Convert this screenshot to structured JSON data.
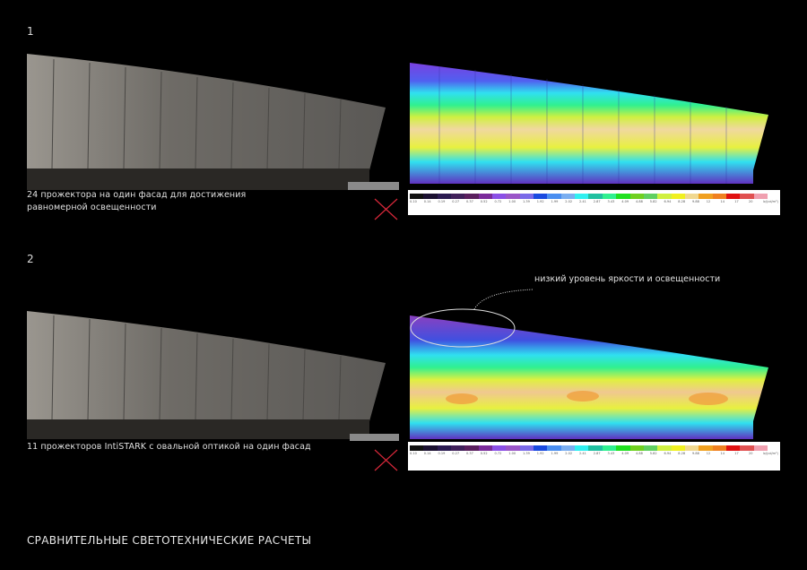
{
  "sections": [
    {
      "number": "1",
      "caption_lines": [
        "24 прожектора  на один фасад для достижения",
        "равномерной освещенности"
      ],
      "status_icon": "red-cross-icon"
    },
    {
      "number": "2",
      "caption_lines": [
        "11 прожекторов IntiSTARK с овальной оптикой на один фасад"
      ],
      "status_icon": "red-cross-icon",
      "annotation": "низкий уровень яркости и освещенности"
    }
  ],
  "legend": {
    "colors": [
      "#111111",
      "#1a1030",
      "#2a1a50",
      "#40205a",
      "#5a1f5e",
      "#7a2a9a",
      "#8b4fe6",
      "#9a55c8",
      "#7a6ae8",
      "#1a4ae0",
      "#4a8ef0",
      "#7aaef0",
      "#30f0f0",
      "#20c0a0",
      "#30f090",
      "#20e020",
      "#70d020",
      "#60d060",
      "#d0f040",
      "#f0f020",
      "#f0d890",
      "#f0a020",
      "#f08020",
      "#e01010",
      "#e05050",
      "#f0a0b0"
    ],
    "values": [
      "0.10",
      "0.14",
      "0.19",
      "0.27",
      "0.37",
      "0.52",
      "0.72",
      "1.00",
      "1.39",
      "1.92",
      "1.99",
      "2.02",
      "2.41",
      "2.87",
      "3.43",
      "4.09",
      "4.88",
      "5.82",
      "6.94",
      "8.28",
      "9.88",
      "12",
      "14",
      "17",
      "20",
      "lx/(cd/m²)"
    ]
  },
  "footer": {
    "title": "СРАВНИТЕЛЬНЫЕ СВЕТОТЕХНИЧЕСКИЕ РАСЧЕТЫ"
  },
  "accent_colors": {
    "cross": "#d8283a",
    "background": "#000000"
  }
}
